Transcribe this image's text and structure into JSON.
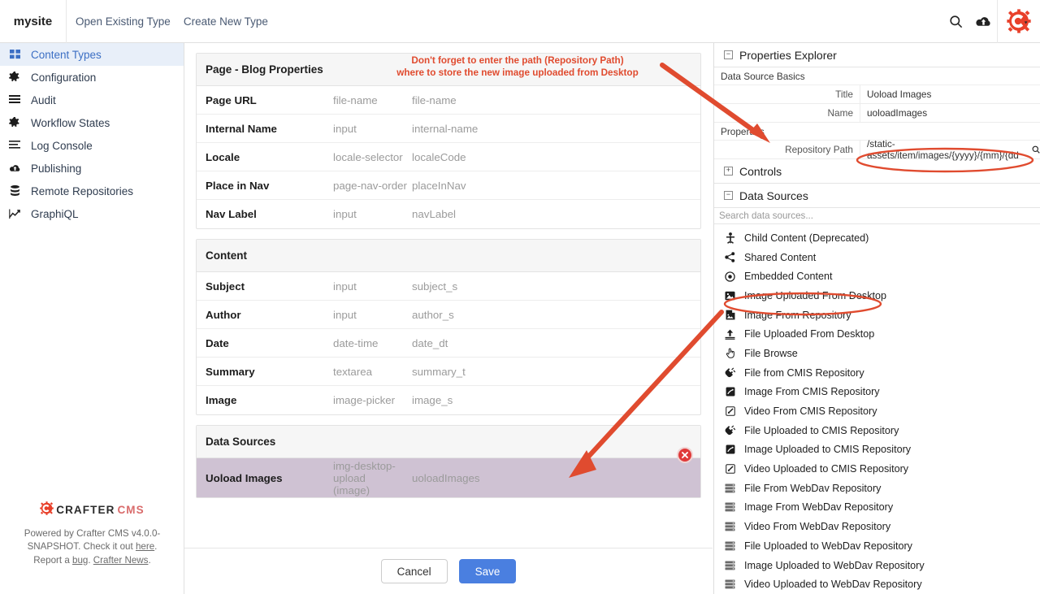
{
  "topbar": {
    "brand": "mysite",
    "nav": [
      {
        "label": "Open Existing Type"
      },
      {
        "label": "Create New Type"
      }
    ],
    "search_icon": "search-icon",
    "publish_icon": "cloud-upload-icon",
    "logo_icon": "crafter-gear-logo"
  },
  "sidebar": {
    "items": [
      {
        "label": "Content Types",
        "icon": "grid-icon",
        "active": true
      },
      {
        "label": "Configuration",
        "icon": "gear-icon",
        "active": false
      },
      {
        "label": "Audit",
        "icon": "list-icon",
        "active": false
      },
      {
        "label": "Workflow States",
        "icon": "gear-icon",
        "active": false
      },
      {
        "label": "Log Console",
        "icon": "list-lines-icon",
        "active": false
      },
      {
        "label": "Publishing",
        "icon": "cloud-upload-icon",
        "active": false
      },
      {
        "label": "Remote Repositories",
        "icon": "database-icon",
        "active": false
      },
      {
        "label": "GraphiQL",
        "icon": "chart-line-icon",
        "active": false
      }
    ],
    "footer": {
      "logo_word1": "CRAFTER",
      "logo_word2": "CMS",
      "text_part1": "Powered by Crafter CMS v4.0.0-SNAPSHOT. Check it out ",
      "link_here": "here",
      "text_part2": ". Report a ",
      "link_bug": "bug",
      "text_part3": ". ",
      "link_news": "Crafter News",
      "text_part4": "."
    }
  },
  "center": {
    "annotation": {
      "line1": "Don't forget to enter the path (Repository Path)",
      "line2": "where to store the new image uploaded from Desktop",
      "color": "#e04b2f"
    },
    "sections": [
      {
        "title": "Page - Blog Properties",
        "rows": [
          {
            "label": "Page URL",
            "type": "file-name",
            "variable": "file-name"
          },
          {
            "label": "Internal Name",
            "type": "input",
            "variable": "internal-name"
          },
          {
            "label": "Locale",
            "type": "locale-selector",
            "variable": "localeCode"
          },
          {
            "label": "Place in Nav",
            "type": "page-nav-order",
            "variable": "placeInNav"
          },
          {
            "label": "Nav Label",
            "type": "input",
            "variable": "navLabel"
          }
        ]
      },
      {
        "title": "Content",
        "rows": [
          {
            "label": "Subject",
            "type": "input",
            "variable": "subject_s"
          },
          {
            "label": "Author",
            "type": "input",
            "variable": "author_s"
          },
          {
            "label": "Date",
            "type": "date-time",
            "variable": "date_dt"
          },
          {
            "label": "Summary",
            "type": "textarea",
            "variable": "summary_t"
          },
          {
            "label": "Image",
            "type": "image-picker",
            "variable": "image_s"
          }
        ]
      }
    ],
    "datasources_section": {
      "title": "Data Sources",
      "selected_row": {
        "label": "Uoload Images",
        "type_line1": "img-desktop-upload",
        "type_line2": "(image)",
        "variable": "uoloadImages",
        "delete_icon": "delete-circle-icon",
        "highlight_color": "#cfc2d3"
      }
    },
    "buttons": {
      "cancel": "Cancel",
      "save": "Save",
      "save_color": "#4a7fe0"
    }
  },
  "right": {
    "header": {
      "title": "Properties Explorer",
      "toggle": "−"
    },
    "groups": [
      {
        "title": "Data Source Basics",
        "rows": [
          {
            "key": "Title",
            "value": "Uoload Images"
          },
          {
            "key": "Name",
            "value": "uoloadImages"
          }
        ]
      },
      {
        "title": "Properties",
        "rows": [
          {
            "key": "Repository Path",
            "value": "/static-assets/item/images/{yyyy}/{mm}/{dd",
            "icon": "search-icon",
            "highlighted": true
          }
        ]
      }
    ],
    "collapsibles": [
      {
        "title": "Controls",
        "toggle": "+"
      },
      {
        "title": "Data Sources",
        "toggle": "−"
      }
    ],
    "search_placeholder": "Search data sources...",
    "datasources": [
      {
        "label": "Child Content (Deprecated)",
        "icon": "person-icon",
        "highlighted": false
      },
      {
        "label": "Shared Content",
        "icon": "share-nodes-icon",
        "highlighted": false
      },
      {
        "label": "Embedded Content",
        "icon": "circle-dot-icon",
        "highlighted": false
      },
      {
        "label": "Image Uploaded From Desktop",
        "icon": "image-icon",
        "highlighted": true
      },
      {
        "label": "Image From Repository",
        "icon": "image-file-icon",
        "highlighted": false
      },
      {
        "label": "File Uploaded From Desktop",
        "icon": "upload-icon",
        "highlighted": false
      },
      {
        "label": "File Browse",
        "icon": "hand-pointer-icon",
        "highlighted": false
      },
      {
        "label": "File from CMIS Repository",
        "icon": "plug-icon",
        "highlighted": false
      },
      {
        "label": "Image From CMIS Repository",
        "icon": "cmis-image-icon",
        "highlighted": false
      },
      {
        "label": "Video From CMIS Repository",
        "icon": "cmis-video-icon",
        "highlighted": false
      },
      {
        "label": "File Uploaded to CMIS Repository",
        "icon": "plug-icon",
        "highlighted": false
      },
      {
        "label": "Image Uploaded to CMIS Repository",
        "icon": "cmis-image-icon",
        "highlighted": false
      },
      {
        "label": "Video Uploaded to CMIS Repository",
        "icon": "cmis-video-icon",
        "highlighted": false
      },
      {
        "label": "File From WebDav Repository",
        "icon": "server-icon",
        "highlighted": false
      },
      {
        "label": "Image From WebDav Repository",
        "icon": "server-icon",
        "highlighted": false
      },
      {
        "label": "Video From WebDav Repository",
        "icon": "server-icon",
        "highlighted": false
      },
      {
        "label": "File Uploaded to WebDav Repository",
        "icon": "server-icon",
        "highlighted": false
      },
      {
        "label": "Image Uploaded to WebDav Repository",
        "icon": "server-icon",
        "highlighted": false
      },
      {
        "label": "Video Uploaded to WebDav Repository",
        "icon": "server-icon",
        "highlighted": false
      }
    ]
  }
}
